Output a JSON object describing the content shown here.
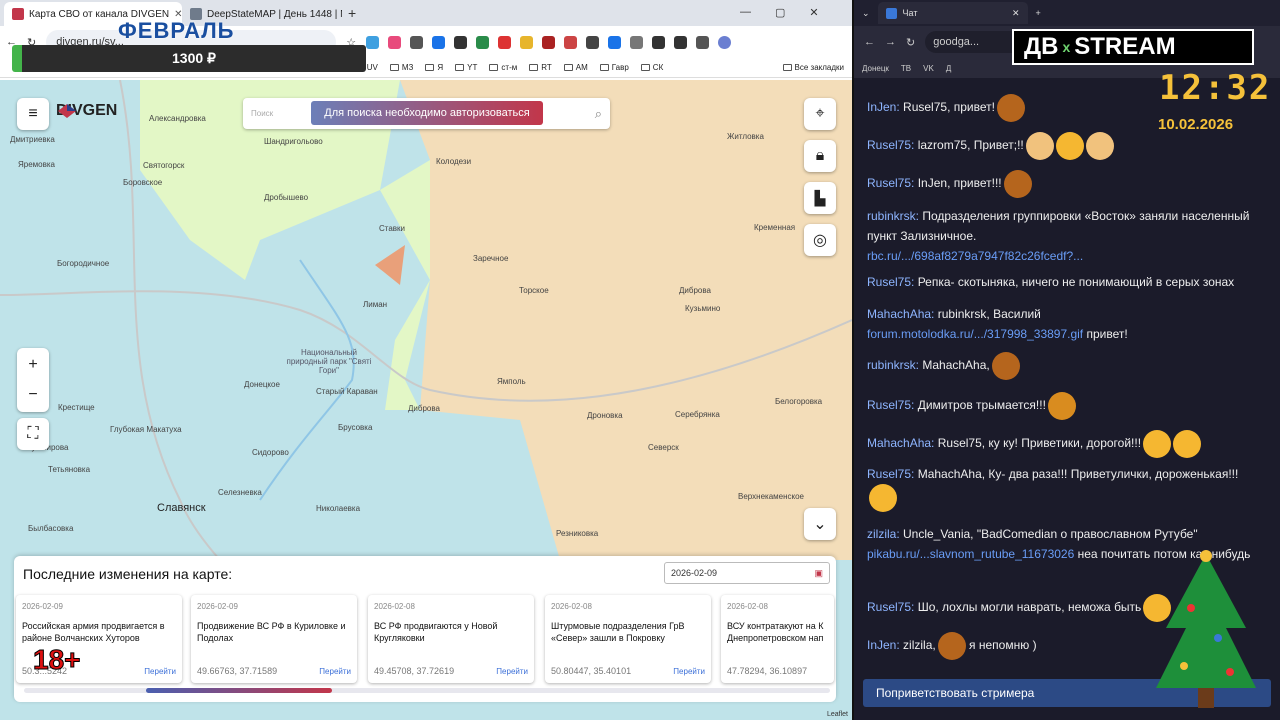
{
  "left_browser": {
    "tabs": [
      {
        "title": "Карта СВО от канала DIVGEN",
        "active": true
      },
      {
        "title": "DeepStateMAP | День 1448 | М",
        "active": false
      }
    ],
    "url": "divgen.ru/sv...",
    "bookmarks": [
      "ДВ",
      "UV",
      "МЗ",
      "Я",
      "YT",
      "ст-м",
      "RT",
      "АМ",
      "Гавр",
      "СК",
      "Все закладки"
    ]
  },
  "overlay": {
    "month": "ФЕВРАЛЬ",
    "price": "1300 ₽",
    "age": "18+"
  },
  "map": {
    "logo": "DIVGEN",
    "search_placeholder": "Поиск",
    "auth_button": "Для поиска необходимо авторизоваться",
    "zoom_in": "+",
    "zoom_out": "−",
    "attribution": "Leaflet",
    "places": [
      {
        "name": "Александровка"
      },
      {
        "name": "Дмитриевка"
      },
      {
        "name": "Шандригольово"
      },
      {
        "name": "Колодези"
      },
      {
        "name": "Житловка"
      },
      {
        "name": "Яремовка"
      },
      {
        "name": "Боровское"
      },
      {
        "name": "Дробышево"
      },
      {
        "name": "Ставки"
      },
      {
        "name": "Кременная"
      },
      {
        "name": "Богородичное"
      },
      {
        "name": "Заречное"
      },
      {
        "name": "Лиман"
      },
      {
        "name": "Торское"
      },
      {
        "name": "Диброва"
      },
      {
        "name": "Кузьмино"
      },
      {
        "name": "Национальный природный парк \"Святі Гори\""
      },
      {
        "name": "Донецкое"
      },
      {
        "name": "Ямполь"
      },
      {
        "name": "Белогоровка"
      },
      {
        "name": "Крестище"
      },
      {
        "name": "Старый Караван"
      },
      {
        "name": "Дибрoва"
      },
      {
        "name": "Дроновка"
      },
      {
        "name": "Серебрянка"
      },
      {
        "name": "Глубокая Макатуха"
      },
      {
        "name": "Брусовка"
      },
      {
        "name": "Сидорово"
      },
      {
        "name": "Северск"
      },
      {
        "name": "Селезневка"
      },
      {
        "name": "Славянск"
      },
      {
        "name": "Николаевка"
      },
      {
        "name": "Верхнекаменское"
      },
      {
        "name": "Резниковка"
      },
      {
        "name": "Былбасовка"
      },
      {
        "name": "Святогорск"
      },
      {
        "name": "Кушнирова"
      },
      {
        "name": "Тетьяновка"
      }
    ]
  },
  "changes_panel": {
    "title": "Последние изменения на карте:",
    "date": "2026-02-09",
    "cards": [
      {
        "date": "2026-02-09",
        "text": "Российская армия продвигается в районе Волчанских Хуторов",
        "coords": "50.3...5242",
        "link": "Перейти"
      },
      {
        "date": "2026-02-09",
        "text": "Продвижение ВС РФ в Куриловке и Подолах",
        "coords": "49.66763, 37.71589",
        "link": "Перейти"
      },
      {
        "date": "2026-02-08",
        "text": "ВС РФ продвигаются у Новой Кругляковки",
        "coords": "49.45708, 37.72619",
        "link": "Перейти"
      },
      {
        "date": "2026-02-08",
        "text": "Штурмовые подразделения ГрВ «Север» зашли в Покровку",
        "coords": "50.80447, 35.40101",
        "link": "Перейти"
      },
      {
        "date": "2026-02-08",
        "text": "ВСУ контратакуют на К Днепропетровском нап",
        "coords": "47.78294, 36.10897",
        "link": "Перейти"
      }
    ]
  },
  "right_browser": {
    "tab_title": "Чат",
    "url": "goodga...",
    "bookmarks": [
      "Донецк",
      "ТВ",
      "VK",
      "Д"
    ]
  },
  "stream": {
    "brand_left": "ДВ",
    "brand_x": "x",
    "brand_right": "STREAM",
    "time": "12:32",
    "date": "10.02.2026"
  },
  "chat": {
    "messages": [
      {
        "user": "InJen:",
        "text": " Rusel75, привет!",
        "emoji_colors": [
          "#b5651d"
        ]
      },
      {
        "user": "Rusel75:",
        "text": " lazrom75, Привет;!!",
        "emoji_colors": [
          "#f1c27d",
          "#f5b731",
          "#f1c27d"
        ]
      },
      {
        "user": "Rusel75:",
        "text": " InJen, привет!!!",
        "emoji_colors": [
          "#b5651d"
        ]
      },
      {
        "user": "rubinkrsk:",
        "text": " Подразделения группировки «Восток» заняли населенный пункт Зализничное.",
        "link": "rbc.ru/.../698af8279a7947f82c26fcedf?...",
        "emoji_colors": []
      },
      {
        "user": "Rusel75:",
        "text": " Репка- скотыняка, ничего не понимающий в серых зонах",
        "emoji_colors": []
      },
      {
        "user": "MahachAha:",
        "text": " rubinkrsk, Василий",
        "link": "forum.motolodka.ru/.../317998_33897.gif",
        "tail": " привет!",
        "emoji_colors": []
      },
      {
        "user": "rubinkrsk:",
        "text": " MahachAha,",
        "emoji_colors": [
          "#b5651d"
        ]
      },
      {
        "user": "Rusel75:",
        "text": " Димитров трымается!!!",
        "emoji_colors": [
          "#d98c1f"
        ]
      },
      {
        "user": "MahachAha:",
        "text": " Rusel75, ку ку! Приветики, дорогой!!!",
        "emoji_colors": [
          "#f5b731",
          "#f5b731"
        ]
      },
      {
        "user": "Rusel75:",
        "text": " MahachAha, Ку- два раза!!! Приветулички, дороженькая!!!",
        "emoji_colors": [
          "#f5b731"
        ]
      },
      {
        "user": "zilzila:",
        "text": " Uncle_Vania, \"BadComedian о православном Рутубе\"",
        "link": "pikabu.ru/...slavnom_rutube_11673026",
        "tail": " неа почитать потом как-нибудь",
        "emoji_colors": []
      },
      {
        "user": "Rusel75:",
        "text": " Шо, лохлы могли наврать, неможа быть",
        "emoji_colors": [
          "#f5b731"
        ]
      },
      {
        "user": "InJen:",
        "text": " zilzila,",
        "tail": " я непомню )",
        "emoji_colors": [
          "#b5651d"
        ]
      }
    ],
    "greet_button": "Поприветствовать стримера"
  },
  "colors": {
    "russian_zone": "#f3ddb9",
    "ukrainian_zone": "#bfe3e9",
    "contested": "#e3f7c6",
    "accent": "#c2364a"
  }
}
